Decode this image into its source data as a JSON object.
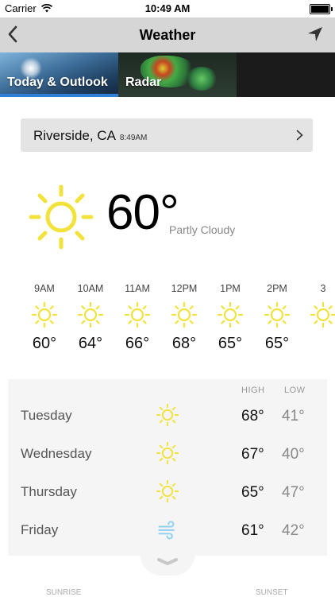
{
  "status_bar": {
    "carrier": "Carrier",
    "time": "10:49 AM"
  },
  "nav": {
    "title": "Weather",
    "back_icon": "chevron-left-icon",
    "location_icon": "location-arrow-icon"
  },
  "tabs": [
    {
      "label": "Today & Outlook",
      "selected": true
    },
    {
      "label": "Radar",
      "selected": false
    },
    {
      "label": ""
    }
  ],
  "location": {
    "city": "Riverside, CA",
    "time": "8:49AM"
  },
  "current": {
    "temp": "60°",
    "condition": "Partly Cloudy",
    "icon": "sun-icon"
  },
  "hourly": [
    {
      "time": "9AM",
      "temp": "60°",
      "icon": "sun-icon"
    },
    {
      "time": "10AM",
      "temp": "64°",
      "icon": "sun-icon"
    },
    {
      "time": "11AM",
      "temp": "66°",
      "icon": "sun-icon"
    },
    {
      "time": "12PM",
      "temp": "68°",
      "icon": "sun-icon"
    },
    {
      "time": "1PM",
      "temp": "65°",
      "icon": "sun-icon"
    },
    {
      "time": "2PM",
      "temp": "65°",
      "icon": "sun-icon"
    },
    {
      "time": "3",
      "temp": "",
      "icon": "sun-icon"
    }
  ],
  "daily": {
    "high_label": "HIGH",
    "low_label": "LOW",
    "days": [
      {
        "day": "Tuesday",
        "high": "68°",
        "low": "41°",
        "icon": "sun-icon"
      },
      {
        "day": "Wednesday",
        "high": "67°",
        "low": "40°",
        "icon": "sun-icon"
      },
      {
        "day": "Thursday",
        "high": "65°",
        "low": "47°",
        "icon": "sun-icon"
      },
      {
        "day": "Friday",
        "high": "61°",
        "low": "42°",
        "icon": "wind-icon"
      }
    ]
  },
  "bottom": {
    "sunrise_label": "SUNRISE",
    "sunset_label": "SUNSET"
  },
  "colors": {
    "sun": "#f2e23c",
    "wind": "#8fd0ee",
    "tab_indicator": "#2f7fd6"
  }
}
